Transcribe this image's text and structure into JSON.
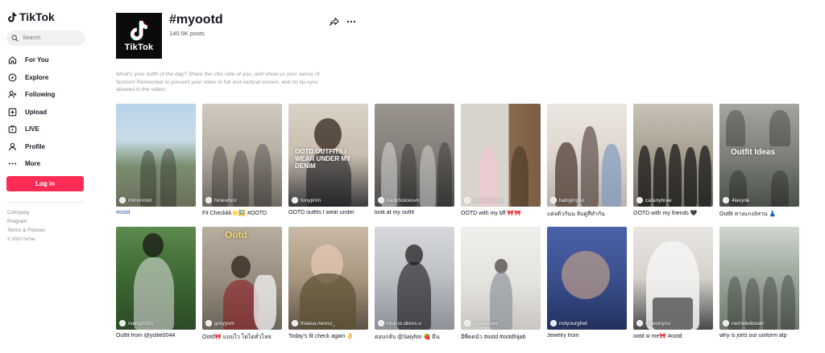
{
  "brand": {
    "name": "TikTok"
  },
  "search": {
    "placeholder": "Search"
  },
  "nav": [
    {
      "label": "For You",
      "icon": "home-icon"
    },
    {
      "label": "Explore",
      "icon": "compass-icon"
    },
    {
      "label": "Following",
      "icon": "following-icon"
    },
    {
      "label": "Upload",
      "icon": "upload-icon"
    },
    {
      "label": "LIVE",
      "icon": "live-icon"
    },
    {
      "label": "Profile",
      "icon": "profile-icon"
    },
    {
      "label": "More",
      "icon": "more-icon"
    }
  ],
  "login": {
    "label": "Log in"
  },
  "footer": {
    "links": [
      "Company",
      "Program",
      "Terms & Policies"
    ],
    "copyright": "© 2023 TikTok"
  },
  "header": {
    "avatar_text": "TikTok",
    "title": "#myootd",
    "posts": "140.5K posts",
    "description": "What's your outfit of the day? Share the chic side of you, and show us your sense of fashion! Remember to present your video in full and vertical screen, and no lip-sync allowed in the video!"
  },
  "colors": {
    "accent": "#fe2c55",
    "text": "#161823",
    "muted": "#8a8b91"
  },
  "videos": [
    {
      "username": "minnnnnd",
      "caption": "#ootd",
      "overlay": ""
    },
    {
      "username": "hinewtscr",
      "caption": "Fit Checkkk🌟🖼️ #OOTD",
      "overlay": ""
    },
    {
      "username": "tooyprim",
      "caption": "OOTD outfits I wear under",
      "overlay": "OOTD OUTFITS I WEAR UNDER MY DENIM"
    },
    {
      "username": "badchoicesvn",
      "caption": "look at my outfit",
      "overlay": ""
    },
    {
      "username": "nteyaspareis",
      "caption": "OOTD with my bff 🎀🎀",
      "overlay": ""
    },
    {
      "username": "babyjingko",
      "caption": "แต่งตัวกันน จับคู่สีทำกัน",
      "overlay": ""
    },
    {
      "username": "catanybrae",
      "caption": "OOTD with my friends 🖤",
      "overlay": ""
    },
    {
      "username": "4laxyok",
      "caption": "Outfit ทางแกง3สวน 👗",
      "overlay": "Outfit Ideas"
    },
    {
      "username": "nuing3350",
      "caption": "Outfit from @yollie0044",
      "overlay": ""
    },
    {
      "username": "greyysm",
      "caption": "Ootd🎀 แบบไว โตไดทั่วไหจ",
      "overlay": "Ootd"
    },
    {
      "username": "thiaisa.nennu_",
      "caption": "Today's fit check again 👌",
      "overlay": ""
    },
    {
      "username": "nice.to.dress.u",
      "caption": "ตอบกลับ @Saiyfon 🍓 มีน",
      "overlay": ""
    },
    {
      "username": "eeeee.eee",
      "caption": "อีพีดตนัว #ootd #ootdhijab",
      "overlay": ""
    },
    {
      "username": "notyourghet",
      "caption": "Jewelry from",
      "overlay": ""
    },
    {
      "username": "vibesinyou",
      "caption": "ootd w me🎀 #ootd",
      "overlay": ""
    },
    {
      "username": "rachelwibsiah",
      "caption": "why is jorts our uniform atp",
      "overlay": ""
    }
  ]
}
